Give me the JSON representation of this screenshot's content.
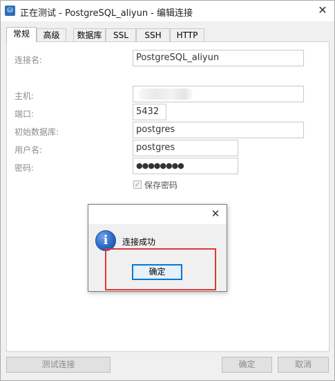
{
  "window": {
    "title": "正在测试 - PostgreSQL_aliyun - 编辑连接",
    "app_icon_glyph": "♕"
  },
  "tabs": [
    {
      "label": "常规",
      "active": true
    },
    {
      "label": "高级",
      "active": false
    },
    {
      "label": "数据库",
      "active": false
    },
    {
      "label": "SSL",
      "active": false
    },
    {
      "label": "SSH",
      "active": false
    },
    {
      "label": "HTTP",
      "active": false
    }
  ],
  "form": {
    "connection_name_label": "连接名:",
    "connection_name_value": "PostgreSQL_aliyun",
    "host_label": "主机:",
    "host_value": "",
    "port_label": "端口:",
    "port_value": "5432",
    "initial_db_label": "初始数据库:",
    "initial_db_value": "postgres",
    "username_label": "用户名:",
    "username_value": "postgres",
    "password_label": "密码:",
    "password_value": "●●●●●●●●",
    "save_password_label": "保存密码",
    "save_password_checked": true
  },
  "footer": {
    "test_connection_label": "测试连接",
    "ok_label": "确定",
    "cancel_label": "取消"
  },
  "dialog": {
    "message": "连接成功",
    "ok_label": "确定",
    "info_icon_glyph": "i",
    "close_glyph": "✕"
  },
  "colors": {
    "highlight": "#e03535",
    "focus_border": "#0078d7"
  }
}
